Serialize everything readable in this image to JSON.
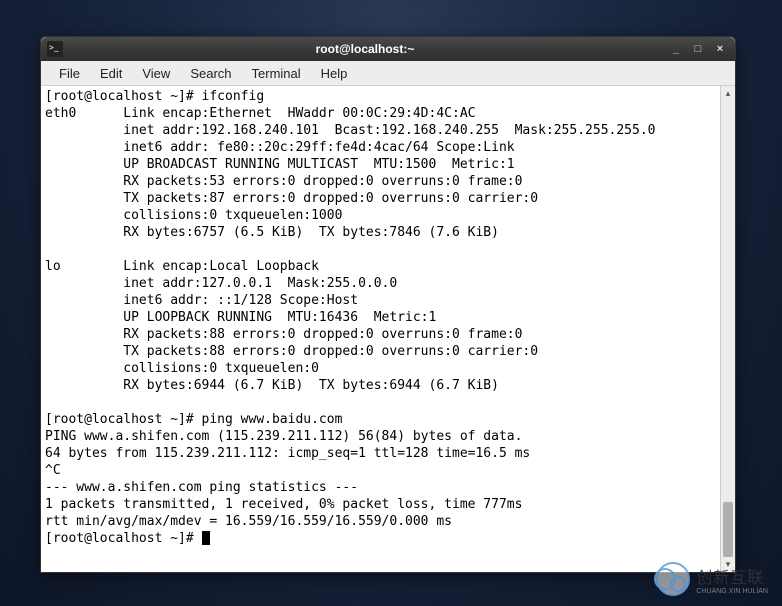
{
  "window": {
    "title": "root@localhost:~"
  },
  "menu": {
    "file": "File",
    "edit": "Edit",
    "view": "View",
    "search": "Search",
    "terminal": "Terminal",
    "help": "Help"
  },
  "term": {
    "line01": "[root@localhost ~]# ifconfig",
    "line02": "eth0      Link encap:Ethernet  HWaddr 00:0C:29:4D:4C:AC",
    "line03": "          inet addr:192.168.240.101  Bcast:192.168.240.255  Mask:255.255.255.0",
    "line04": "          inet6 addr: fe80::20c:29ff:fe4d:4cac/64 Scope:Link",
    "line05": "          UP BROADCAST RUNNING MULTICAST  MTU:1500  Metric:1",
    "line06": "          RX packets:53 errors:0 dropped:0 overruns:0 frame:0",
    "line07": "          TX packets:87 errors:0 dropped:0 overruns:0 carrier:0",
    "line08": "          collisions:0 txqueuelen:1000",
    "line09": "          RX bytes:6757 (6.5 KiB)  TX bytes:7846 (7.6 KiB)",
    "line10": "",
    "line11": "lo        Link encap:Local Loopback",
    "line12": "          inet addr:127.0.0.1  Mask:255.0.0.0",
    "line13": "          inet6 addr: ::1/128 Scope:Host",
    "line14": "          UP LOOPBACK RUNNING  MTU:16436  Metric:1",
    "line15": "          RX packets:88 errors:0 dropped:0 overruns:0 frame:0",
    "line16": "          TX packets:88 errors:0 dropped:0 overruns:0 carrier:0",
    "line17": "          collisions:0 txqueuelen:0",
    "line18": "          RX bytes:6944 (6.7 KiB)  TX bytes:6944 (6.7 KiB)",
    "line19": "",
    "line20": "[root@localhost ~]# ping www.baidu.com",
    "line21": "PING www.a.shifen.com (115.239.211.112) 56(84) bytes of data.",
    "line22": "64 bytes from 115.239.211.112: icmp_seq=1 ttl=128 time=16.5 ms",
    "line23": "^C",
    "line24": "--- www.a.shifen.com ping statistics ---",
    "line25": "1 packets transmitted, 1 received, 0% packet loss, time 777ms",
    "line26": "rtt min/avg/max/mdev = 16.559/16.559/16.559/0.000 ms",
    "line27": "[root@localhost ~]# "
  },
  "controls": {
    "min": "_",
    "max": "□",
    "close": "×"
  },
  "watermark": {
    "brand": "创新互联",
    "sub": "CHUANG XIN HULIAN"
  }
}
